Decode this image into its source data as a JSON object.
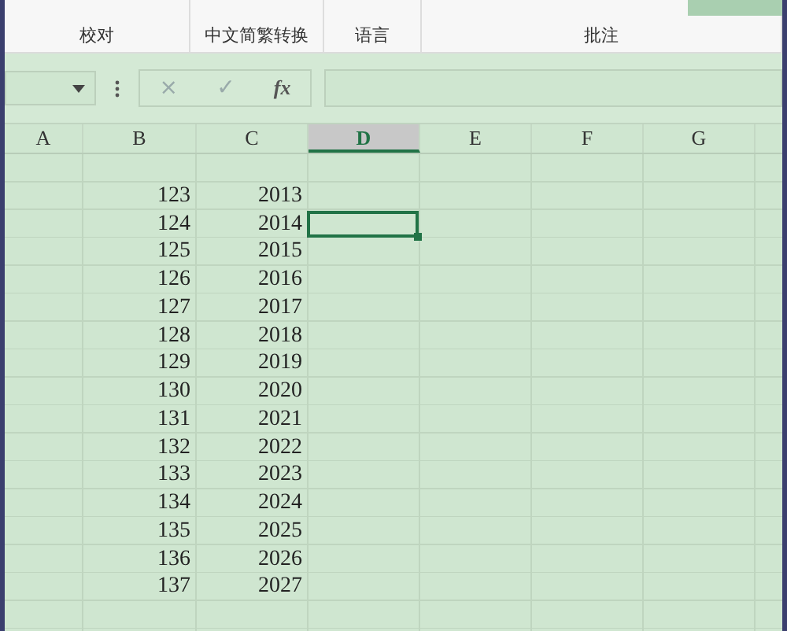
{
  "ribbon": {
    "groups": [
      {
        "label": "校对"
      },
      {
        "label": "中文简繁转换"
      },
      {
        "label": "语言"
      },
      {
        "label": "批注"
      }
    ]
  },
  "formula_bar": {
    "cancel": "×",
    "confirm": "✓",
    "function": "fx"
  },
  "columns": [
    {
      "label": "A",
      "selected": false
    },
    {
      "label": "B",
      "selected": false
    },
    {
      "label": "C",
      "selected": false
    },
    {
      "label": "D",
      "selected": true
    },
    {
      "label": "E",
      "selected": false
    },
    {
      "label": "F",
      "selected": false
    },
    {
      "label": "G",
      "selected": false
    }
  ],
  "rows": [
    {
      "b": "",
      "c": "",
      "selected": false
    },
    {
      "b": "123",
      "c": "2013",
      "selected": false
    },
    {
      "b": "124",
      "c": "2014",
      "selected": true
    },
    {
      "b": "125",
      "c": "2015",
      "selected": false
    },
    {
      "b": "126",
      "c": "2016",
      "selected": false
    },
    {
      "b": "127",
      "c": "2017",
      "selected": false
    },
    {
      "b": "128",
      "c": "2018",
      "selected": false
    },
    {
      "b": "129",
      "c": "2019",
      "selected": false
    },
    {
      "b": "130",
      "c": "2020",
      "selected": false
    },
    {
      "b": "131",
      "c": "2021",
      "selected": false
    },
    {
      "b": "132",
      "c": "2022",
      "selected": false
    },
    {
      "b": "133",
      "c": "2023",
      "selected": false
    },
    {
      "b": "134",
      "c": "2024",
      "selected": false
    },
    {
      "b": "135",
      "c": "2025",
      "selected": false
    },
    {
      "b": "136",
      "c": "2026",
      "selected": false
    },
    {
      "b": "137",
      "c": "2027",
      "selected": false
    },
    {
      "b": "",
      "c": "",
      "selected": false
    }
  ]
}
